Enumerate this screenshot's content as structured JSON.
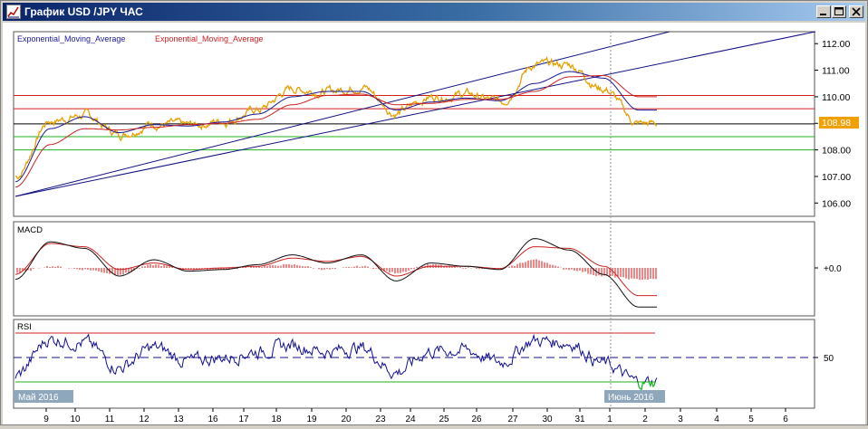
{
  "window": {
    "title": "График USD /JPY  ЧАС",
    "minimize_icon": "minimize-icon",
    "maximize_icon": "maximize-icon",
    "close_icon": "close-icon"
  },
  "colors": {
    "price": "#e6a000",
    "ema_fast": "#1a1a99",
    "ema_slow": "#cc2222",
    "trendline": "#101080",
    "resistance": "#d42020",
    "support": "#20b020",
    "current_line": "#000000",
    "macd_hist": "#dd1111",
    "rsi": "#101090",
    "rsi_overbought": "#cc00cc",
    "rsi_oversold": "#00cc00",
    "badge_bg": "#f0a000",
    "date_badge_bg": "#8fa7bc"
  },
  "legend": {
    "ema1": "Exponential_Moving_Average",
    "ema2": "Exponential_Moving_Average"
  },
  "macd_label": "MACD",
  "rsi_label": "RSI",
  "price_axis": {
    "ticks": [
      "112.00",
      "111.00",
      "110.00",
      "109.00",
      "108.00",
      "107.00",
      "106.00"
    ],
    "current": "108.98"
  },
  "macd_axis": {
    "zero": "+0.0"
  },
  "rsi_axis": {
    "mid": "50"
  },
  "levels": {
    "red_upper": 110.05,
    "red_lower": 109.55,
    "current": 108.98,
    "green_upper": 108.5,
    "green_lower": 108.0
  },
  "date_badges": {
    "start": "Май 2016",
    "june": "Июнь 2016"
  },
  "date_axis": [
    "9",
    "10",
    "11",
    "12",
    "13",
    "16",
    "17",
    "18",
    "19",
    "20",
    "23",
    "24",
    "25",
    "26",
    "27",
    "30",
    "31",
    "1",
    "2",
    "3",
    "4",
    "5",
    "6"
  ],
  "chart_data": {
    "type": "line",
    "instrument": "USD /JPY",
    "timeframe": "ЧАС",
    "x": [
      "9",
      "10",
      "11",
      "12",
      "13",
      "16",
      "17",
      "18",
      "19",
      "20",
      "23",
      "24",
      "25",
      "26",
      "27",
      "30",
      "31",
      "1",
      "2"
    ],
    "series": [
      {
        "name": "Exponential_Moving_Average",
        "values": [
          106.8,
          108.8,
          109.25,
          108.65,
          108.95,
          108.9,
          109.05,
          109.35,
          110.0,
          110.2,
          110.2,
          109.5,
          109.8,
          109.95,
          109.85,
          110.5,
          110.95,
          110.7,
          109.5
        ]
      },
      {
        "name": "Exponential_Moving_Average",
        "values": [
          106.6,
          108.2,
          108.8,
          108.75,
          108.85,
          108.95,
          109.0,
          109.15,
          109.7,
          110.05,
          110.1,
          109.7,
          109.75,
          109.9,
          109.9,
          110.2,
          110.75,
          110.8,
          110.0
        ]
      }
    ],
    "price_close": [
      107.0,
      109.1,
      109.3,
      108.6,
      109.0,
      108.9,
      109.1,
      109.5,
      110.3,
      110.2,
      110.4,
      109.4,
      110.0,
      110.1,
      109.8,
      111.2,
      111.2,
      110.3,
      108.98
    ],
    "macd": [
      -0.35,
      0.8,
      0.6,
      -0.25,
      0.25,
      -0.1,
      -0.05,
      0.1,
      0.4,
      0.15,
      0.4,
      -0.4,
      0.15,
      0.05,
      -0.05,
      0.9,
      0.55,
      -0.2,
      -1.2
    ],
    "macd_signal": [
      -0.2,
      0.75,
      0.65,
      -0.05,
      0.15,
      -0.05,
      0.0,
      0.05,
      0.3,
      0.2,
      0.35,
      -0.25,
      0.05,
      0.05,
      -0.02,
      0.65,
      0.6,
      0.05,
      -0.85
    ],
    "rsi": [
      35,
      65,
      62,
      42,
      58,
      47,
      50,
      55,
      60,
      55,
      58,
      38,
      55,
      56,
      46,
      64,
      62,
      45,
      30
    ],
    "rsi_levels": {
      "overbought": 70,
      "mid": 50,
      "oversold": 30
    },
    "ylim": [
      105.5,
      112.45
    ],
    "trendlines": [
      {
        "from": [
          "9",
          106.25
        ],
        "to": [
          "3",
          112.45
        ]
      },
      {
        "from": [
          "9",
          106.25
        ],
        "to": [
          "6",
          112.45
        ]
      }
    ]
  }
}
